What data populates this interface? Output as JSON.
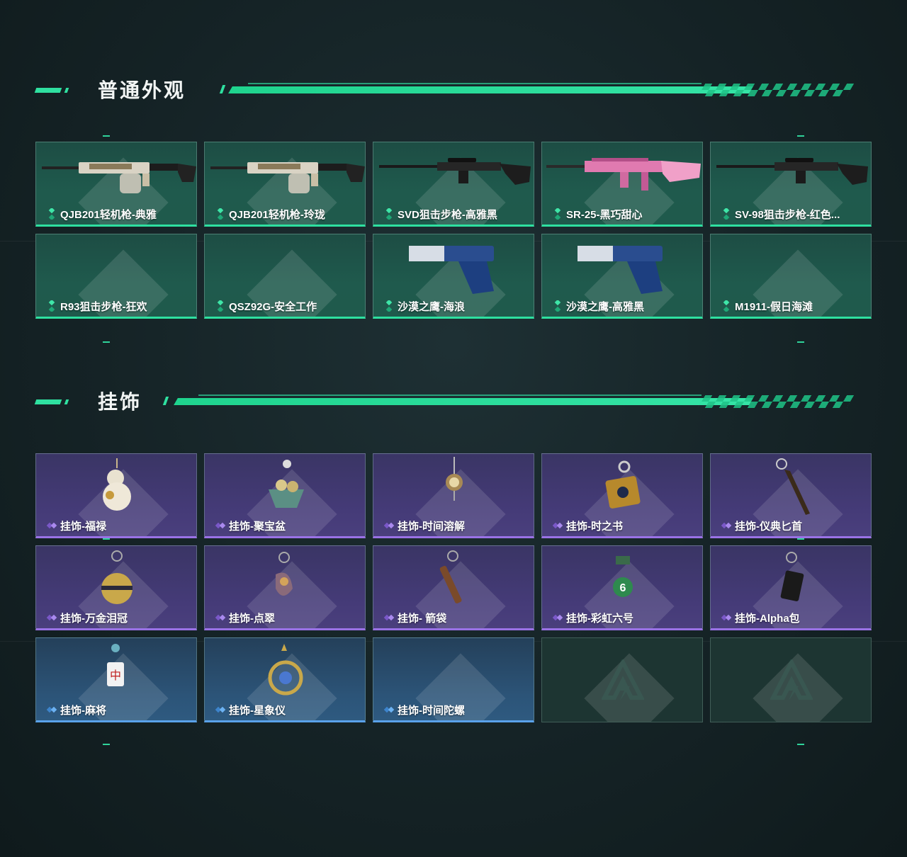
{
  "sections": {
    "skins": {
      "title": "普通外观",
      "items": [
        {
          "label": "QJB201轻机枪-典雅",
          "rarity": "green",
          "icon": "machine-gun-icon"
        },
        {
          "label": "QJB201轻机枪-玲珑",
          "rarity": "green",
          "icon": "machine-gun-icon"
        },
        {
          "label": "SVD狙击步枪-高雅黑",
          "rarity": "green",
          "icon": "sniper-rifle-icon"
        },
        {
          "label": "SR-25-黑巧甜心",
          "rarity": "green",
          "icon": "rifle-icon"
        },
        {
          "label": "SV-98狙击步枪-红色...",
          "rarity": "green",
          "icon": "sniper-rifle-icon"
        },
        {
          "label": "R93狙击步枪-狂欢",
          "rarity": "green",
          "icon": "none"
        },
        {
          "label": "QSZ92G-安全工作",
          "rarity": "green",
          "icon": "none"
        },
        {
          "label": "沙漠之鹰-海浪",
          "rarity": "green",
          "icon": "pistol-icon"
        },
        {
          "label": "沙漠之鹰-高雅黑",
          "rarity": "green",
          "icon": "pistol-icon"
        },
        {
          "label": "M1911-假日海滩",
          "rarity": "green",
          "icon": "none"
        }
      ]
    },
    "charms": {
      "title": "挂饰",
      "items": [
        {
          "label": "挂饰-福禄",
          "rarity": "purple",
          "icon": "gourd-charm-icon"
        },
        {
          "label": "挂饰-聚宝盆",
          "rarity": "purple",
          "icon": "treasure-bowl-charm-icon"
        },
        {
          "label": "挂饰-时间溶解",
          "rarity": "purple",
          "icon": "clock-charm-icon"
        },
        {
          "label": "挂饰-时之书",
          "rarity": "purple",
          "icon": "book-charm-icon"
        },
        {
          "label": "挂饰-仪典匕首",
          "rarity": "purple",
          "icon": "dagger-charm-icon"
        },
        {
          "label": "挂饰-万金泪冠",
          "rarity": "purple",
          "icon": "crown-charm-icon"
        },
        {
          "label": "挂饰-点翠",
          "rarity": "purple",
          "icon": "ornament-charm-icon"
        },
        {
          "label": "挂饰- 箭袋",
          "rarity": "purple",
          "icon": "quiver-charm-icon"
        },
        {
          "label": "挂饰-彩虹六号",
          "rarity": "purple",
          "icon": "rainbow-six-charm-icon"
        },
        {
          "label": "挂饰-Alpha包",
          "rarity": "purple",
          "icon": "bag-charm-icon"
        },
        {
          "label": "挂饰-麻将",
          "rarity": "blue",
          "icon": "mahjong-charm-icon"
        },
        {
          "label": "挂饰-星象仪",
          "rarity": "blue",
          "icon": "astrolabe-charm-icon"
        },
        {
          "label": "挂饰-时间陀螺",
          "rarity": "blue",
          "icon": "none"
        },
        {
          "label": "",
          "rarity": "empty",
          "icon": "placeholder-logo-icon"
        },
        {
          "label": "",
          "rarity": "empty",
          "icon": "placeholder-logo-icon"
        }
      ]
    }
  },
  "colors": {
    "accent": "#2fe0a0",
    "green_rarity": "#2ee0a0",
    "purple_rarity": "#9a72e6",
    "blue_rarity": "#5aa2ea"
  }
}
